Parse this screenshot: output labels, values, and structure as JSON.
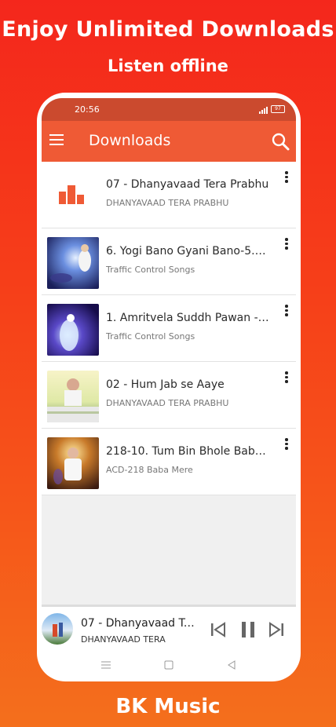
{
  "promo": {
    "title": "Enjoy Unlimited Downloads",
    "subtitle": "Listen offline",
    "footer": "BK Music"
  },
  "status_bar": {
    "time": "20:56",
    "battery": "97"
  },
  "toolbar": {
    "title": "Downloads"
  },
  "downloads": [
    {
      "title": "07 - Dhanyavaad Tera Prabhu",
      "subtitle": "DHANYAVAAD TERA PRABHU"
    },
    {
      "title": "6. Yogi Bano Gyani Bano-5.3...",
      "subtitle": "Traffic Control Songs"
    },
    {
      "title": "1. Amritvela Suddh Pawan - ...",
      "subtitle": "Traffic Control Songs"
    },
    {
      "title": "02 - Hum Jab se Aaye",
      "subtitle": "DHANYAVAAD TERA PRABHU"
    },
    {
      "title": "218-10. Tum Bin Bhole Baba ...",
      "subtitle": "ACD-218 Baba Mere"
    }
  ],
  "player": {
    "title": "07 - Dhanyavaad Tera Prabhu",
    "subtitle": "DHANYAVAAD TERA"
  },
  "colors": {
    "accent": "#ef5a35",
    "status_bar": "#cb4a2e",
    "background_top": "#f4271c",
    "background_bottom": "#f46f1c"
  }
}
